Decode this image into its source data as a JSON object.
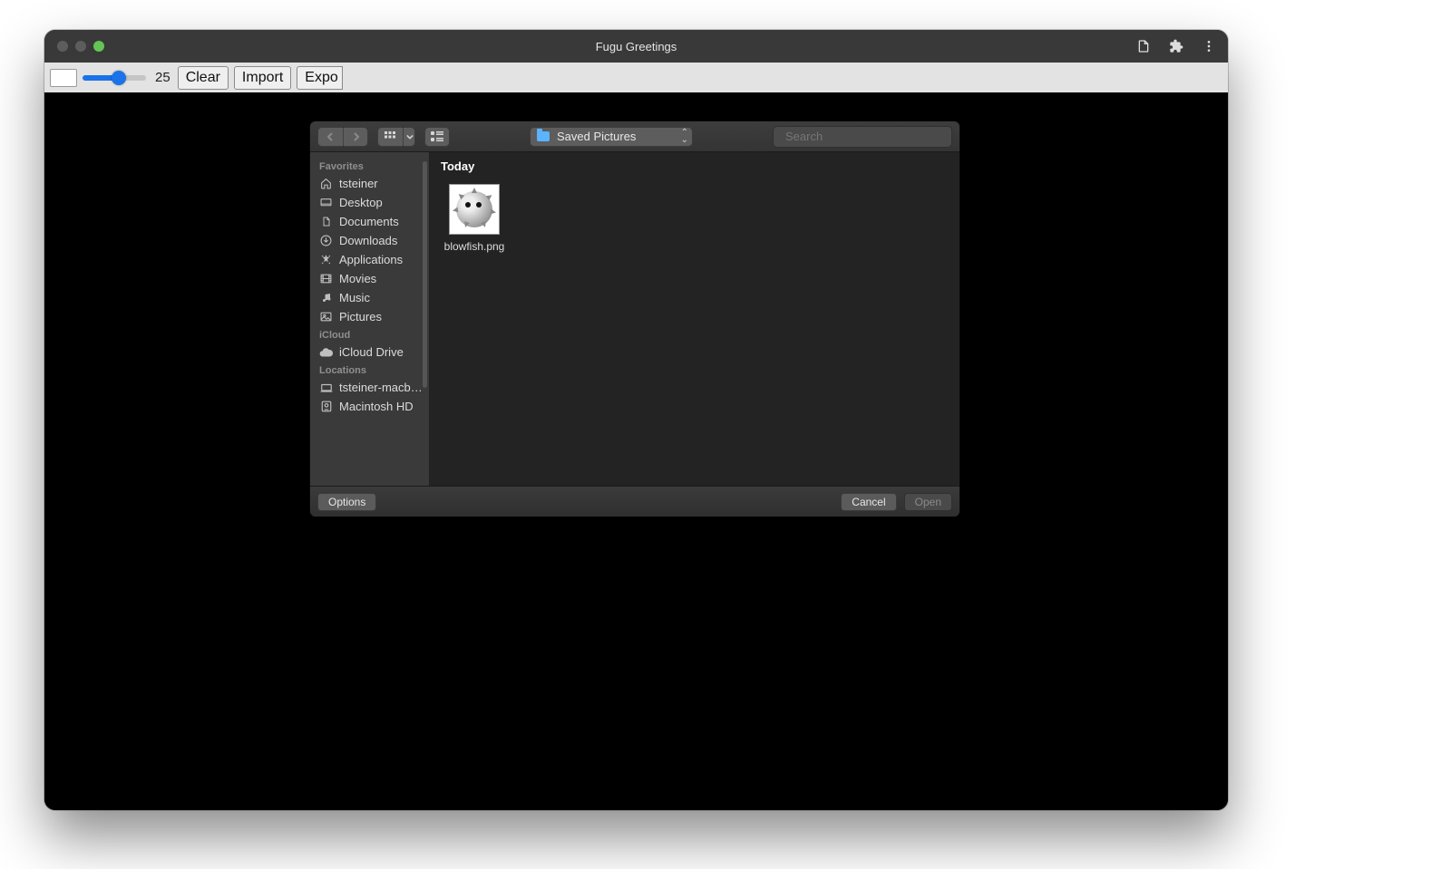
{
  "window": {
    "title": "Fugu Greetings"
  },
  "toolbar": {
    "slider_value": "25",
    "clear_label": "Clear",
    "import_label": "Import",
    "export_label_visible": "Expo"
  },
  "dialog": {
    "folder": {
      "name": "Saved Pictures"
    },
    "search": {
      "placeholder": "Search"
    },
    "sidebar": {
      "sections": [
        {
          "label": "Favorites",
          "items": [
            {
              "icon": "home-icon",
              "label": "tsteiner"
            },
            {
              "icon": "desktop-icon",
              "label": "Desktop"
            },
            {
              "icon": "doc-icon",
              "label": "Documents"
            },
            {
              "icon": "download-icon",
              "label": "Downloads"
            },
            {
              "icon": "apps-icon",
              "label": "Applications"
            },
            {
              "icon": "movie-icon",
              "label": "Movies"
            },
            {
              "icon": "music-icon",
              "label": "Music"
            },
            {
              "icon": "picture-icon",
              "label": "Pictures"
            }
          ]
        },
        {
          "label": "iCloud",
          "items": [
            {
              "icon": "cloud-icon",
              "label": "iCloud Drive"
            }
          ]
        },
        {
          "label": "Locations",
          "items": [
            {
              "icon": "laptop-icon",
              "label": "tsteiner-macb…"
            },
            {
              "icon": "disk-icon",
              "label": "Macintosh HD"
            }
          ]
        }
      ]
    },
    "content": {
      "group_label": "Today",
      "files": [
        {
          "name": "blowfish.png"
        }
      ]
    },
    "buttons": {
      "options": "Options",
      "cancel": "Cancel",
      "open": "Open"
    }
  }
}
